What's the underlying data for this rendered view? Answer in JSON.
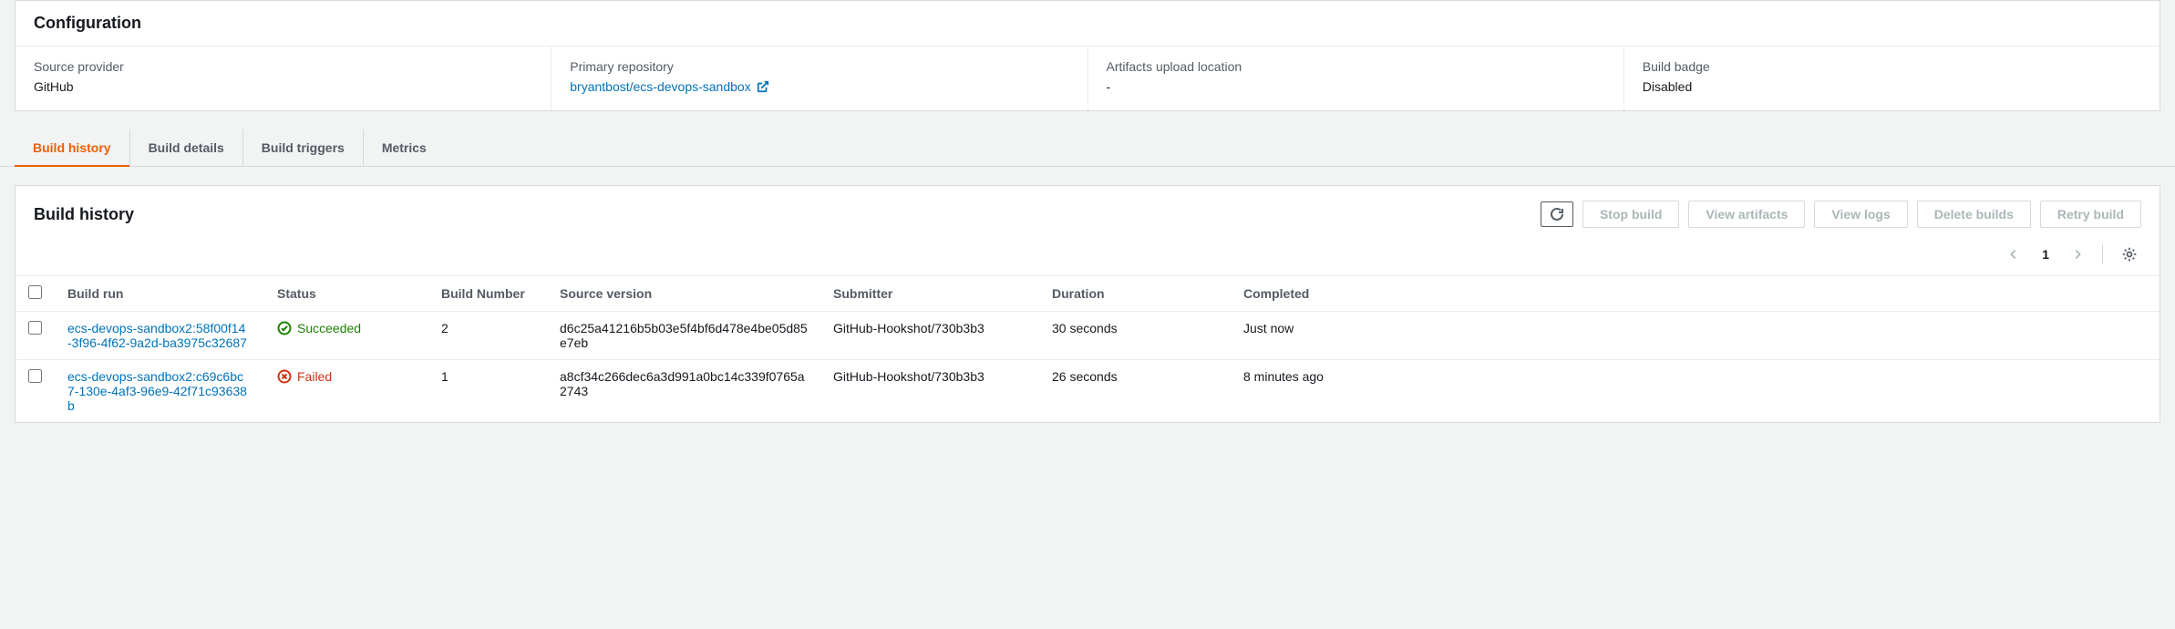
{
  "config": {
    "title": "Configuration",
    "fields": [
      {
        "label": "Source provider",
        "value": "GitHub"
      },
      {
        "label": "Primary repository",
        "link": "bryantbost/ecs-devops-sandbox"
      },
      {
        "label": "Artifacts upload location",
        "value": "-"
      },
      {
        "label": "Build badge",
        "value": "Disabled"
      }
    ]
  },
  "tabs": [
    {
      "label": "Build history",
      "active": true
    },
    {
      "label": "Build details",
      "active": false
    },
    {
      "label": "Build triggers",
      "active": false
    },
    {
      "label": "Metrics",
      "active": false
    }
  ],
  "history": {
    "title": "Build history",
    "actions": {
      "stop": "Stop build",
      "view_artifacts": "View artifacts",
      "view_logs": "View logs",
      "delete": "Delete builds",
      "retry": "Retry build"
    },
    "page": "1",
    "columns": {
      "run": "Build run",
      "status": "Status",
      "number": "Build Number",
      "source": "Source version",
      "submitter": "Submitter",
      "duration": "Duration",
      "completed": "Completed"
    },
    "rows": [
      {
        "run": "ecs-devops-sandbox2:58f00f14-3f96-4f62-9a2d-ba3975c32687",
        "status": "Succeeded",
        "status_kind": "succeeded",
        "number": "2",
        "source": "d6c25a41216b5b03e5f4bf6d478e4be05d85e7eb",
        "submitter": "GitHub-Hookshot/730b3b3",
        "duration": "30 seconds",
        "completed": "Just now"
      },
      {
        "run": "ecs-devops-sandbox2:c69c6bc7-130e-4af3-96e9-42f71c93638b",
        "status": "Failed",
        "status_kind": "failed",
        "number": "1",
        "source": "a8cf34c266dec6a3d991a0bc14c339f0765a2743",
        "submitter": "GitHub-Hookshot/730b3b3",
        "duration": "26 seconds",
        "completed": "8 minutes ago"
      }
    ]
  }
}
